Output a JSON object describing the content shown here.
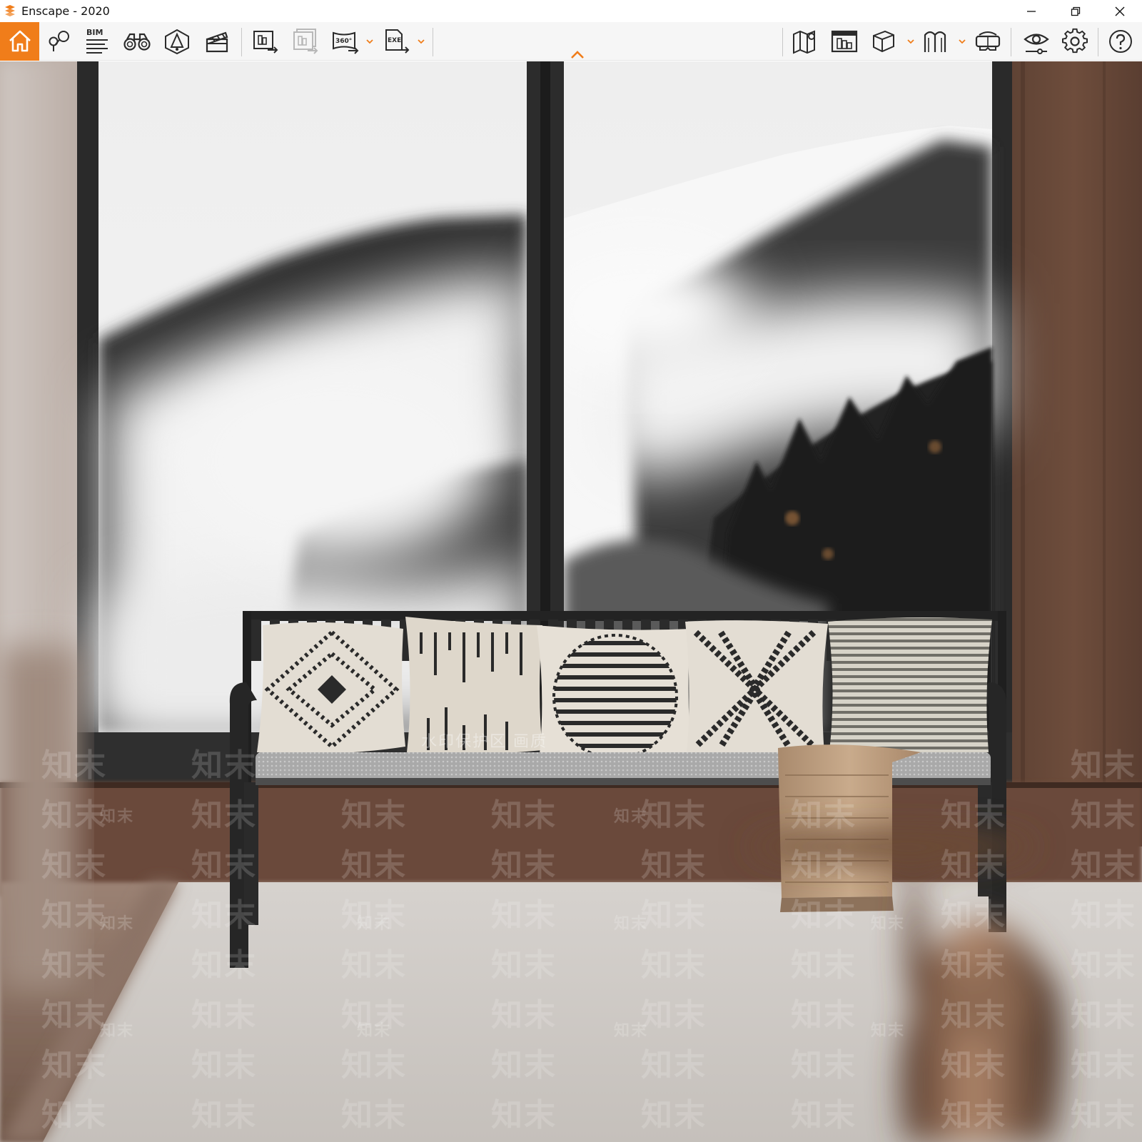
{
  "window": {
    "title": "Enscape - 2020",
    "controls": [
      "minimize-icon",
      "restore-icon",
      "close-icon"
    ]
  },
  "colors": {
    "accent": "#f07d1a",
    "toolbar_bg": "#f6f6f6",
    "icon": "#2b2b2b"
  },
  "toolbar": {
    "left_group": [
      {
        "name": "home",
        "icon": "home-icon",
        "active": true
      },
      {
        "name": "views",
        "icon": "map-pin-icon"
      },
      {
        "name": "bim",
        "icon": "bim-icon",
        "label": "BIM"
      },
      {
        "name": "walk-mode",
        "icon": "binoculars-icon"
      },
      {
        "name": "asset-library",
        "icon": "asset-cube-icon"
      },
      {
        "name": "video-editor",
        "icon": "clapperboard-icon"
      }
    ],
    "export_group": [
      {
        "name": "screenshot",
        "icon": "export-image-icon"
      },
      {
        "name": "batch-render",
        "icon": "batch-export-icon",
        "disabled": true
      },
      {
        "name": "panorama",
        "icon": "panorama-360-icon",
        "label": "360°",
        "dropdown": true
      },
      {
        "name": "standalone",
        "icon": "exe-export-icon",
        "label": "EXE",
        "dropdown": true
      }
    ],
    "right_group": [
      {
        "name": "map",
        "icon": "map-icon"
      },
      {
        "name": "render-view",
        "icon": "render-view-icon"
      },
      {
        "name": "section",
        "icon": "box-icon",
        "dropdown": true
      },
      {
        "name": "collaboration",
        "icon": "arch-icon",
        "dropdown": true
      },
      {
        "name": "vr-headset",
        "icon": "vr-headset-icon"
      },
      {
        "name": "visual-settings",
        "icon": "eye-icon"
      },
      {
        "name": "settings",
        "icon": "gear-icon"
      },
      {
        "name": "help",
        "icon": "help-icon"
      }
    ]
  },
  "viewport": {
    "watermark_text": "知末",
    "watermark_zone_text": "水印保护区 画质"
  }
}
